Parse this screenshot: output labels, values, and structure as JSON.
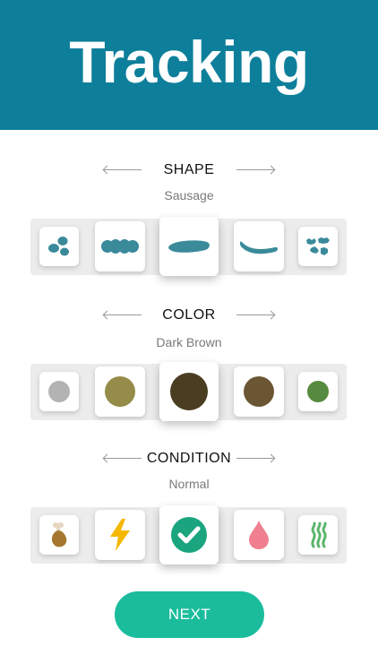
{
  "header": {
    "title": "Tracking"
  },
  "shape": {
    "title": "SHAPE",
    "value": "Sausage",
    "options": [
      "separate-lumps-icon",
      "lumpy-sausage-icon",
      "sausage-icon",
      "snake-icon",
      "fluffy-pieces-icon"
    ],
    "selected_index": 2
  },
  "color": {
    "title": "COLOR",
    "value": "Dark Brown",
    "swatches": [
      "#b3b3b3",
      "#958c49",
      "#4a3d22",
      "#6b5634",
      "#568a3e"
    ],
    "selected_index": 2
  },
  "condition": {
    "title": "CONDITION",
    "value": "Normal",
    "options": [
      "drumstick-icon",
      "lightning-icon",
      "check-icon",
      "drop-icon",
      "steam-icon"
    ],
    "selected_index": 2
  },
  "footer": {
    "next_label": "NEXT"
  },
  "colors": {
    "header": "#0e7f9b",
    "shape_icon": "#3a8a9a",
    "button": "#1abc9c"
  }
}
